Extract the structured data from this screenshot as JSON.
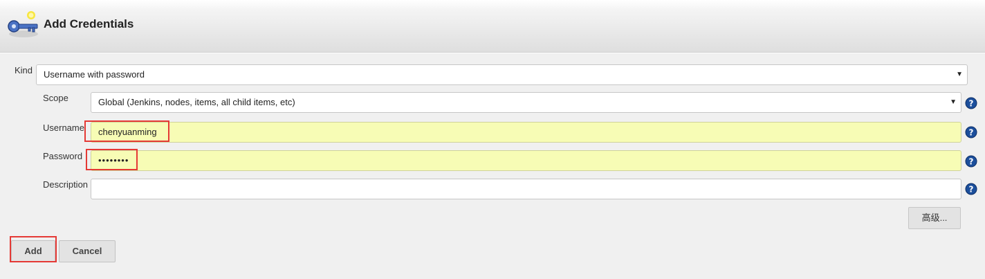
{
  "header": {
    "title": "Add Credentials",
    "icon": "credentials-key-icon"
  },
  "form": {
    "kind": {
      "label": "Kind",
      "value": "Username with password"
    },
    "scope": {
      "label": "Scope",
      "value": "Global (Jenkins, nodes, items, all child items, etc)"
    },
    "username": {
      "label": "Username",
      "value": "chenyuanming"
    },
    "password": {
      "label": "Password",
      "masked_value": "••••••••"
    },
    "description": {
      "label": "Description",
      "value": ""
    },
    "advanced_label": "高级..."
  },
  "actions": {
    "add_label": "Add",
    "cancel_label": "Cancel"
  },
  "icons": {
    "help": "help-icon",
    "dropdown": "dropdown-arrow-icon"
  },
  "colors": {
    "autofill_bg": "#f7fcb5",
    "highlight_border": "#e53935",
    "help_blue": "#1c4f9c",
    "panel_bg": "#f0f0f0"
  }
}
